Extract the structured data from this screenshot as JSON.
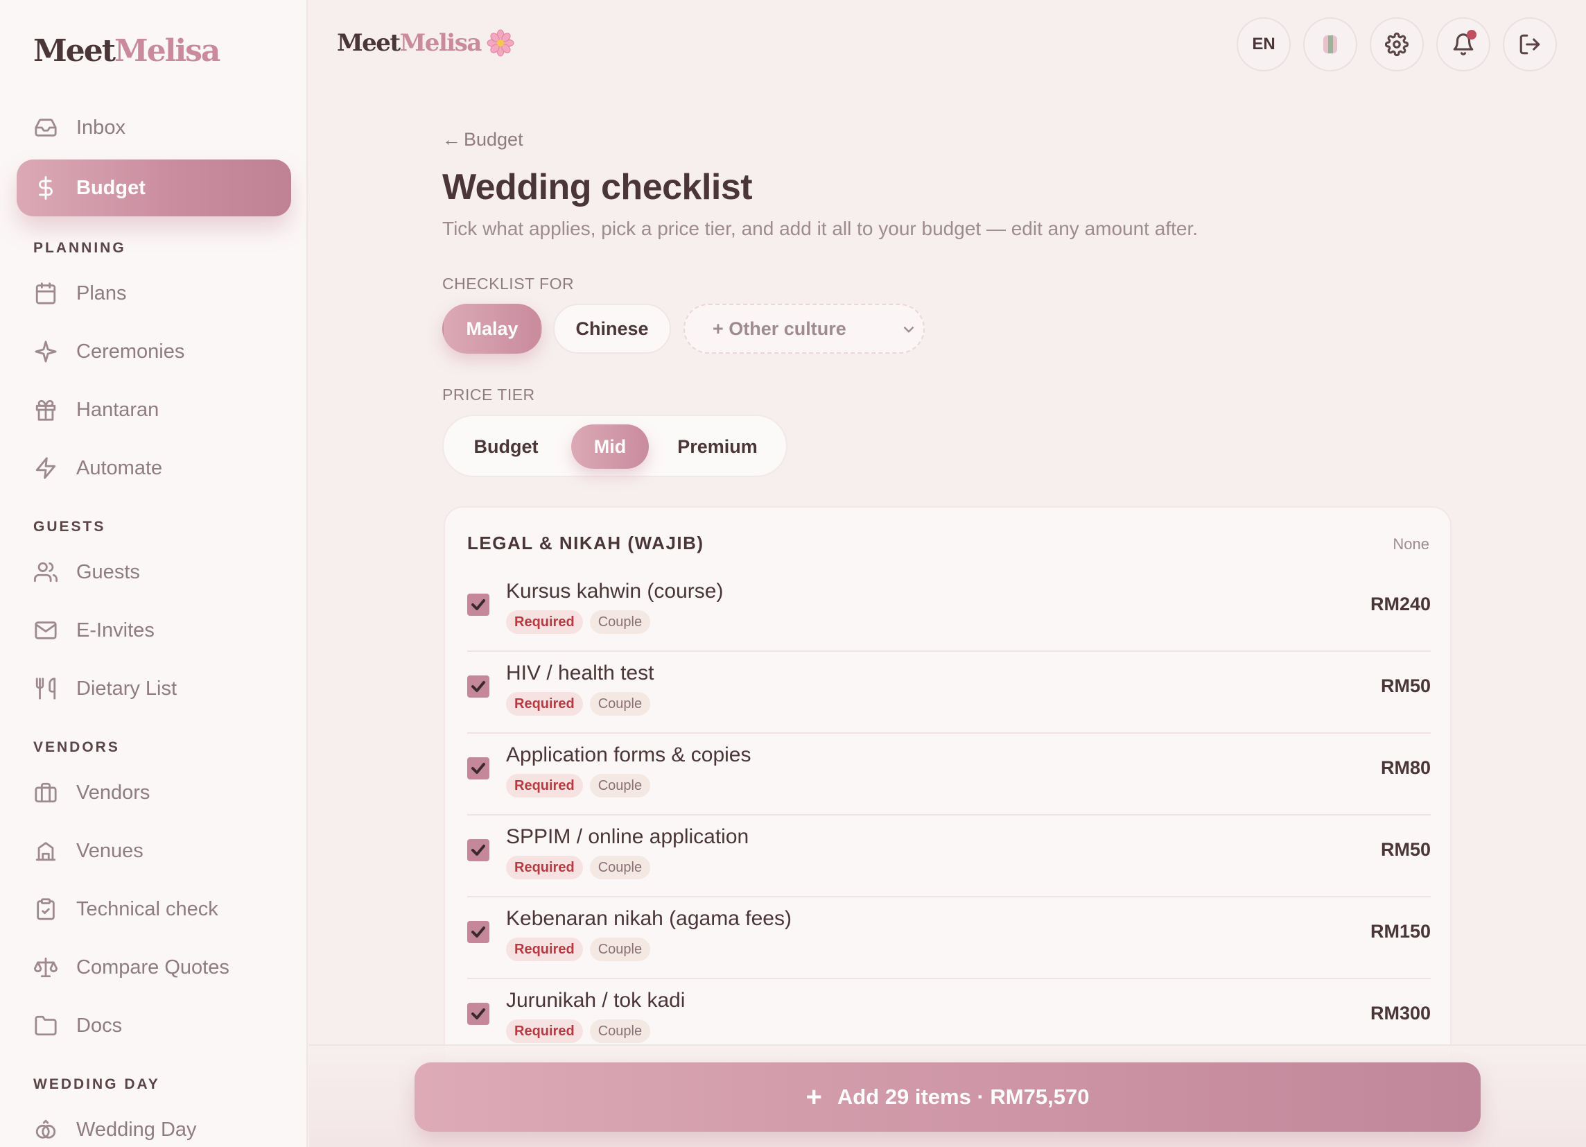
{
  "sidebar": {
    "brand_part1": "Meet",
    "brand_part2": "Melisa",
    "top_items": [
      {
        "label": "Inbox",
        "icon": "inbox-icon"
      },
      {
        "label": "Budget",
        "icon": "dollar-icon",
        "active": true
      }
    ],
    "sections": [
      {
        "title": "PLANNING",
        "items": [
          {
            "label": "Plans",
            "icon": "calendar-icon"
          },
          {
            "label": "Ceremonies",
            "icon": "sparkle-icon"
          },
          {
            "label": "Hantaran",
            "icon": "gift-icon"
          },
          {
            "label": "Automate",
            "icon": "bolt-icon"
          }
        ]
      },
      {
        "title": "GUESTS",
        "items": [
          {
            "label": "Guests",
            "icon": "users-icon"
          },
          {
            "label": "E-Invites",
            "icon": "mail-icon"
          },
          {
            "label": "Dietary List",
            "icon": "utensils-icon"
          }
        ]
      },
      {
        "title": "VENDORS",
        "items": [
          {
            "label": "Vendors",
            "icon": "briefcase-icon"
          },
          {
            "label": "Venues",
            "icon": "building-icon"
          },
          {
            "label": "Technical check",
            "icon": "clipboard-check-icon"
          },
          {
            "label": "Compare Quotes",
            "icon": "scale-icon"
          },
          {
            "label": "Docs",
            "icon": "folder-icon"
          }
        ]
      },
      {
        "title": "WEDDING DAY",
        "items": [
          {
            "label": "Wedding Day",
            "icon": "rings-icon"
          }
        ]
      }
    ]
  },
  "topbar": {
    "brand_part1": "Meet",
    "brand_part2": "Melisa",
    "language": "EN",
    "buttons": [
      "language-button",
      "theme-swatch-button",
      "settings-button",
      "notifications-button",
      "logout-button"
    ]
  },
  "main": {
    "back_label": "Budget",
    "title": "Wedding checklist",
    "subtitle": "Tick what applies, pick a price tier, and add it all to your budget — edit any amount after.",
    "checklist_for_label": "CHECKLIST FOR",
    "cultures": [
      "Malay",
      "Chinese"
    ],
    "active_culture": "Malay",
    "other_culture_label": "+ Other culture",
    "price_tier_label": "PRICE TIER",
    "tiers": [
      "Budget",
      "Mid",
      "Premium"
    ],
    "active_tier": "Mid"
  },
  "card": {
    "title": "LEGAL & NIKAH (WAJIB)",
    "none_label": "None",
    "items": [
      {
        "name": "Kursus kahwin (course)",
        "tags": [
          "Required",
          "Couple"
        ],
        "price": "RM240",
        "checked": true
      },
      {
        "name": "HIV / health test",
        "tags": [
          "Required",
          "Couple"
        ],
        "price": "RM50",
        "checked": true
      },
      {
        "name": "Application forms & copies",
        "tags": [
          "Required",
          "Couple"
        ],
        "price": "RM80",
        "checked": true
      },
      {
        "name": "SPPIM / online application",
        "tags": [
          "Required",
          "Couple"
        ],
        "price": "RM50",
        "checked": true
      },
      {
        "name": "Kebenaran nikah (agama fees)",
        "tags": [
          "Required",
          "Couple"
        ],
        "price": "RM150",
        "checked": true
      },
      {
        "name": "Jurunikah / tok kadi",
        "tags": [
          "Required",
          "Couple"
        ],
        "price": "RM300",
        "checked": true
      }
    ]
  },
  "cta": {
    "label": "Add 29 items · RM75,570"
  },
  "colors": {
    "accent": "#c98b9e",
    "accent_light": "#dba9b6",
    "text": "#4a3538",
    "muted": "#8f7c80",
    "required_tag": "#b53a42",
    "background": "#f7eeee"
  }
}
